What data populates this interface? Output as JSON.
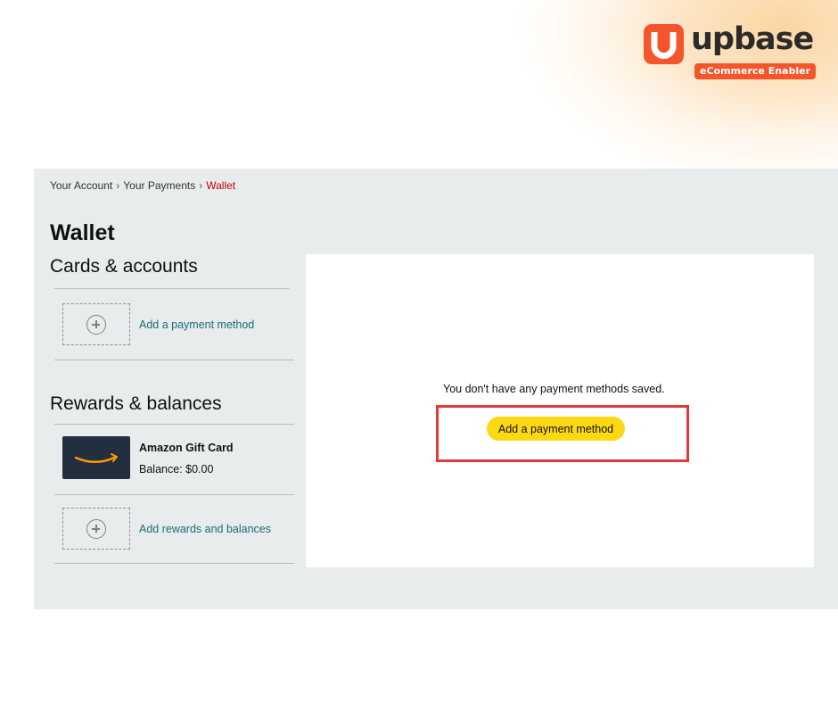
{
  "brand": {
    "logo_word": "upbase",
    "logo_tagline": "eCommerce Enabler",
    "brand_color": "#f4552a",
    "icon": "upbase-u-icon"
  },
  "breadcrumb": {
    "items": [
      "Your Account",
      "Your Payments",
      "Wallet"
    ],
    "separator": "›"
  },
  "page_title": "Wallet",
  "cards_section": {
    "title": "Cards & accounts",
    "add_link": "Add a payment method",
    "icon": "add-circle-icon"
  },
  "rewards_section": {
    "title": "Rewards & balances",
    "gift_card": {
      "name": "Amazon Gift Card",
      "balance": "Balance: $0.00",
      "icon": "amazon-smile-icon"
    },
    "add_link": "Add rewards and balances",
    "icon": "add-circle-icon"
  },
  "main": {
    "empty_message": "You don't have any payment methods saved.",
    "add_button_label": "Add a payment method",
    "button_color": "#ffd814",
    "highlight_color": "#e03a3a"
  },
  "colors": {
    "panel_background": "#e9ecec",
    "link": "#1b6a7a",
    "breadcrumb_current": "#c40000"
  }
}
